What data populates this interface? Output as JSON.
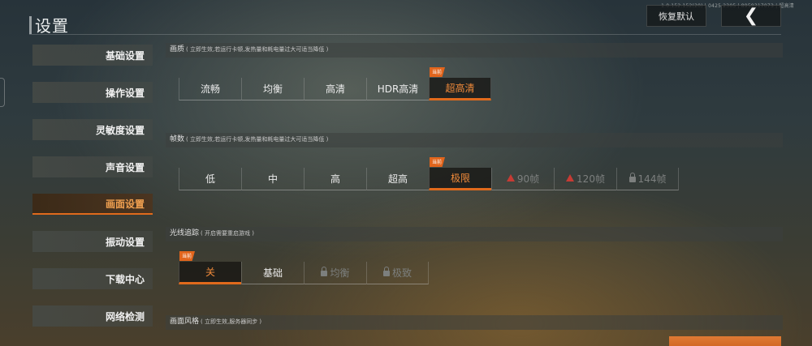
{
  "version": "1.0.152.152(20) | 0425 2305 | 8959317073 | 超高清",
  "header": {
    "title": "设置",
    "restore_label": "恢复默认",
    "back_icon": "chevron-left-icon"
  },
  "sidebar": {
    "items": [
      {
        "label": "基础设置",
        "active": false
      },
      {
        "label": "操作设置",
        "active": false
      },
      {
        "label": "灵敏度设置",
        "active": false
      },
      {
        "label": "声音设置",
        "active": false
      },
      {
        "label": "画面设置",
        "active": true
      },
      {
        "label": "振动设置",
        "active": false
      },
      {
        "label": "下载中心",
        "active": false
      },
      {
        "label": "网络检测",
        "active": false
      }
    ]
  },
  "sections": {
    "quality": {
      "title": "画质",
      "note": "( 立即生效,若运行卡顿,发热量和耗电量过大可适当降低 )",
      "options": [
        "流畅",
        "均衡",
        "高清",
        "HDR高清",
        "超高清"
      ],
      "selected_badge": "当前"
    },
    "framerate": {
      "title": "帧数",
      "note": "( 立即生效,若运行卡顿,发热量和耗电量过大可适当降低 )",
      "options": [
        "低",
        "中",
        "高",
        "超高",
        "极限",
        "90帧",
        "120帧",
        "144帧"
      ],
      "selected_badge": "当前"
    },
    "raytracing": {
      "title": "光线追踪",
      "note": "( 开启需要重启游戏 )",
      "options": [
        "关",
        "基础",
        "均衡",
        "极致"
      ],
      "selected_badge": "当前"
    },
    "style": {
      "title": "画面风格",
      "note": "( 立即生效,服务器同步 )"
    }
  },
  "colors": {
    "accent": "#e06a1c",
    "warning": "#c63b34",
    "disabled": "#7c7f7e"
  }
}
